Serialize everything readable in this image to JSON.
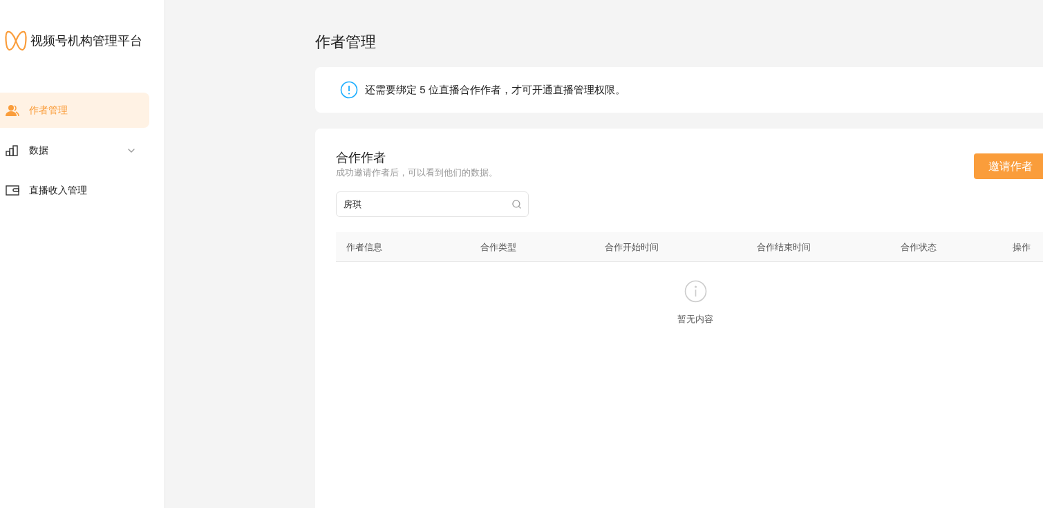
{
  "brand": {
    "title": "视频号机构管理平台"
  },
  "sidebar": {
    "items": [
      {
        "kind": "authors",
        "label": "作者管理",
        "selected": true,
        "expandable": false
      },
      {
        "kind": "data",
        "label": "数据",
        "selected": false,
        "expandable": true
      },
      {
        "kind": "income",
        "label": "直播收入管理",
        "selected": false,
        "expandable": false
      }
    ]
  },
  "page_title": "作者管理",
  "alert": {
    "text": "还需要绑定 5 位直播合作作者，才可开通直播管理权限。"
  },
  "section": {
    "title": "合作作者",
    "subtitle": "成功邀请作者后，可以看到他们的数据。",
    "invite_button": "邀请作者",
    "search": {
      "value": "房琪"
    },
    "table": {
      "columns": [
        "作者信息",
        "合作类型",
        "合作开始时间",
        "合作结束时间",
        "合作状态",
        "操作"
      ],
      "empty_text": "暂无内容"
    }
  }
}
